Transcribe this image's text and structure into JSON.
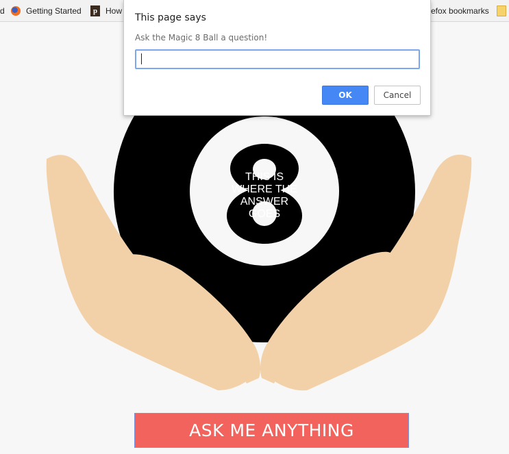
{
  "bookmarks": {
    "items": [
      {
        "label": "d",
        "icon": "none"
      },
      {
        "label": "Getting Started",
        "icon": "firefox-icon"
      },
      {
        "label": "How",
        "icon": "p-icon"
      },
      {
        "label": "efox bookmarks",
        "icon": "none"
      },
      {
        "label": "",
        "icon": "folder-icon"
      }
    ]
  },
  "magic8": {
    "answer": "THIS IS WHERE THE ANSWER GOES",
    "ball_number": "8",
    "ask_button_label": "ASK ME ANYTHING"
  },
  "dialog": {
    "title": "This page says",
    "message": "Ask the Magic 8 Ball a question!",
    "input_value": "",
    "ok_label": "OK",
    "cancel_label": "Cancel"
  },
  "colors": {
    "background": "#f7f7f7",
    "ball": "#000000",
    "hands": "#f2d0a8",
    "button": "#f1635c",
    "ok_button": "#4487f5"
  }
}
